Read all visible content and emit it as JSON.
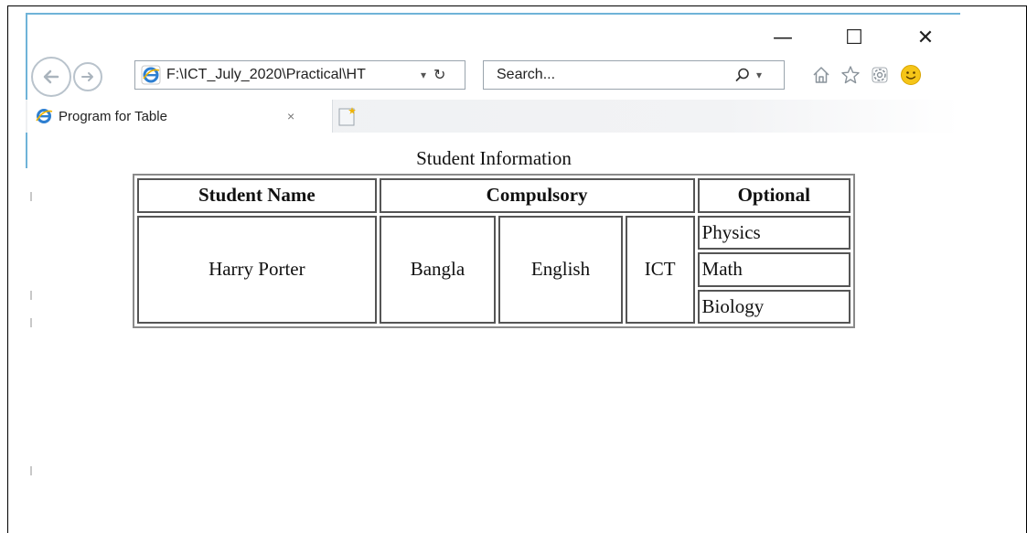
{
  "browser": {
    "window_controls": {
      "minimize": "—",
      "maximize": "☐",
      "close": "✕"
    },
    "address_bar": {
      "url": "F:\\ICT_July_2020\\Practical\\HT",
      "dropdown": "▾",
      "refresh": "↻"
    },
    "search": {
      "placeholder": "Search...",
      "dropdown": "▾"
    },
    "tab": {
      "title": "Program for Table",
      "close": "×"
    },
    "icons": [
      "back-arrow-icon",
      "forward-arrow-icon",
      "ie-icon",
      "search-icon",
      "home-icon",
      "star-icon",
      "gear-icon",
      "smiley-icon",
      "new-tab-icon"
    ]
  },
  "page": {
    "caption": "Student Information",
    "headers": {
      "student_name": "Student Name",
      "compulsory": "Compulsory",
      "optional": "Optional"
    },
    "row": {
      "student_name": "Harry Porter",
      "compulsory": [
        "Bangla",
        "English",
        "ICT"
      ],
      "optional": [
        "Physics",
        "Math",
        "Biology"
      ]
    }
  },
  "colors": {
    "window_border": "#6fb3d8",
    "table_border": "#555555"
  }
}
